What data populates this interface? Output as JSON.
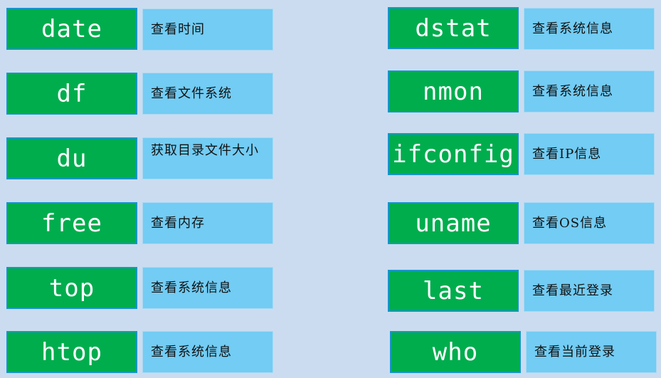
{
  "left": [
    {
      "command": "date",
      "description": "查看时间"
    },
    {
      "command": "df",
      "description": "查看文件系统"
    },
    {
      "command": "du",
      "description": "获取目录文件大小"
    },
    {
      "command": "free",
      "description": "查看内存"
    },
    {
      "command": "top",
      "description": "查看系统信息"
    },
    {
      "command": "htop",
      "description": "查看系统信息"
    }
  ],
  "right": [
    {
      "command": "dstat",
      "description": "查看系统信息"
    },
    {
      "command": "nmon",
      "description": "查看系统信息"
    },
    {
      "command": "ifconfig",
      "description": "查看IP信息"
    },
    {
      "command": "uname",
      "description": "查看OS信息"
    },
    {
      "command": "last",
      "description": "查看最近登录"
    },
    {
      "command": "who",
      "description": "查看当前登录"
    }
  ]
}
